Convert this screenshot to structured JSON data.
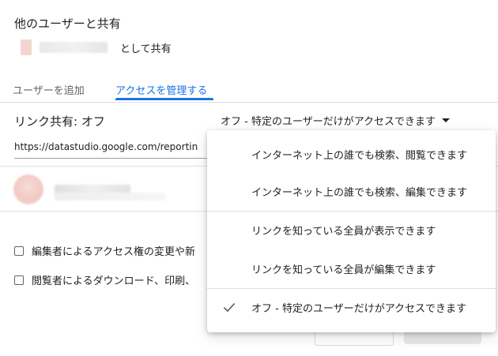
{
  "dialog": {
    "title": "他のユーザーと共有",
    "owner_suffix": "として共有"
  },
  "tabs": [
    {
      "label": "ユーザーを追加",
      "active": false
    },
    {
      "label": "アクセスを管理する",
      "active": true
    }
  ],
  "link_sharing": {
    "label": "リンク共有: オフ",
    "selected": "オフ - 特定のユーザーだけがアクセスできます",
    "url": "https://datastudio.google.com/reportin"
  },
  "options": [
    {
      "label": "編集者によるアクセス権の変更や新",
      "checked": false
    },
    {
      "label": "閲覧者によるダウンロード、印刷、",
      "checked": false
    }
  ],
  "menu": {
    "items": [
      {
        "label": "インターネット上の誰でも検索、閲覧できます",
        "selected": false
      },
      {
        "label": "インターネット上の誰でも検索、編集できます",
        "selected": false
      },
      {
        "label": "リンクを知っている全員が表示できます",
        "selected": false
      },
      {
        "label": "リンクを知っている全員が編集できます",
        "selected": false
      },
      {
        "label": "オフ - 特定のユーザーだけがアクセスできます",
        "selected": true
      }
    ]
  },
  "colors": {
    "accent": "#1a73e8",
    "text": "#202124",
    "muted": "#5f6368",
    "divider": "#e0e0e0"
  }
}
